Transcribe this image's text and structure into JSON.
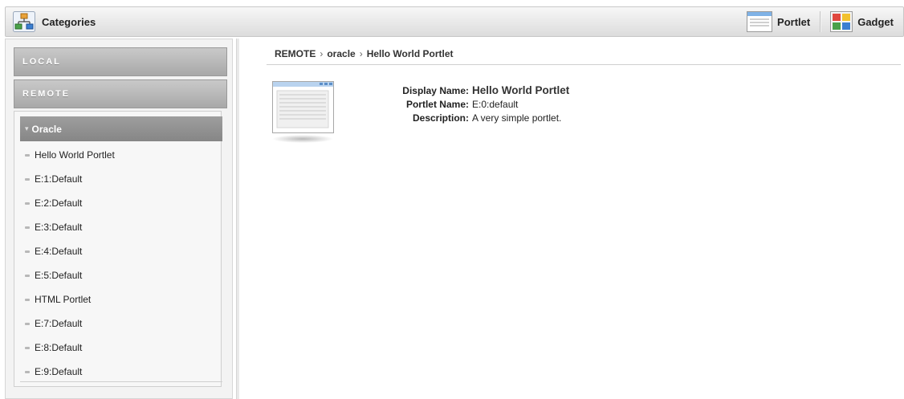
{
  "toolbar": {
    "categories_label": "Categories",
    "portlet_label": "Portlet",
    "gadget_label": "Gadget"
  },
  "sidebar": {
    "local_label": "LOCAL",
    "remote_label": "REMOTE",
    "group": {
      "label": "Oracle",
      "items": [
        "Hello World Portlet",
        "E:1:Default",
        "E:2:Default",
        "E:3:Default",
        "E:4:Default",
        "E:5:Default",
        "HTML Portlet",
        "E:7:Default",
        "E:8:Default",
        "E:9:Default"
      ]
    }
  },
  "breadcrumb": [
    "REMOTE",
    "oracle",
    "Hello World Portlet"
  ],
  "breadcrumb_separator": "›",
  "details": {
    "display_name_label": "Display Name:",
    "display_name_value": "Hello World Portlet",
    "portlet_name_label": "Portlet Name:",
    "portlet_name_value": "E:0:default",
    "description_label": "Description:",
    "description_value": "A very simple portlet."
  }
}
